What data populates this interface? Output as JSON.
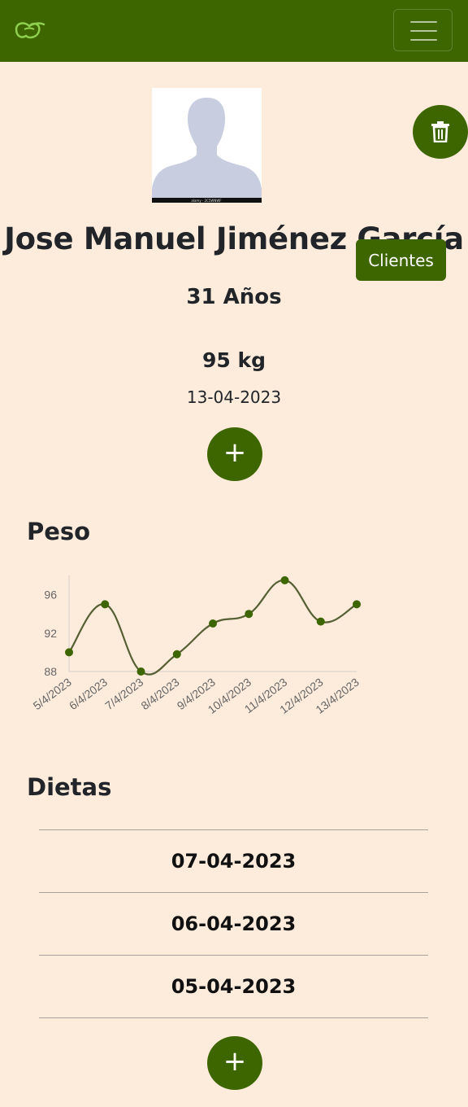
{
  "navbar": {
    "logo_icon": "leaf-logo-icon",
    "menu_icon": "hamburger-menu-icon",
    "brand_color": "#3d6600"
  },
  "avatar": {
    "icon": "user-silhouette-icon",
    "caption": "alamy · 2C5WNWF"
  },
  "actions": {
    "delete_icon": "trash-icon",
    "clientes_label": "Clientes",
    "add_weight_icon": "plus-icon",
    "add_diet_icon": "plus-icon"
  },
  "profile": {
    "name": "Jose Manuel Jiménez García",
    "age": "31 Años",
    "weight": "95 kg",
    "date": "13-04-2023"
  },
  "weight_section": {
    "title": "Peso"
  },
  "chart_data": {
    "type": "line",
    "x": [
      "5/4/2023",
      "6/4/2023",
      "7/4/2023",
      "8/4/2023",
      "9/4/2023",
      "10/4/2023",
      "11/4/2023",
      "12/4/2023",
      "13/4/2023"
    ],
    "values": [
      90,
      95,
      88,
      89.8,
      93,
      94,
      97.5,
      93.2,
      95
    ],
    "ylim": [
      88,
      98
    ],
    "yticks": [
      88,
      92,
      96
    ],
    "line_color": "#555f33",
    "point_color": "#3d6600",
    "grid": false,
    "legend": "none"
  },
  "diets_section": {
    "title": "Dietas",
    "items": [
      "07-04-2023",
      "06-04-2023",
      "05-04-2023"
    ]
  }
}
